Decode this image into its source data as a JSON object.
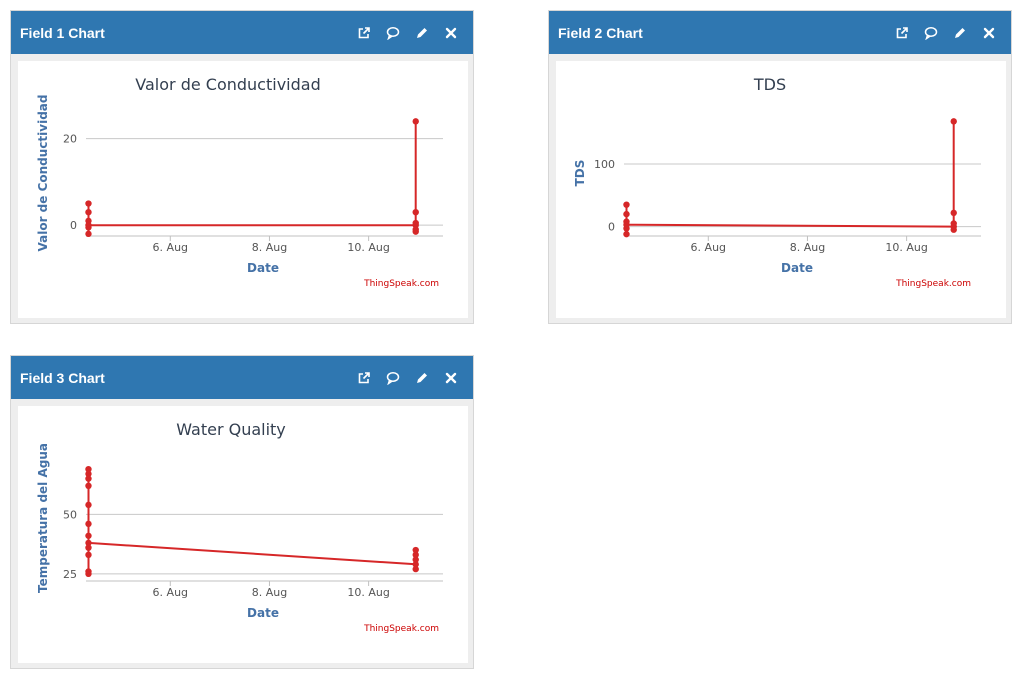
{
  "widgets": [
    {
      "title": "Field 1 Chart",
      "tools": [
        "external-link-icon",
        "comment-icon",
        "pencil-icon",
        "close-icon"
      ],
      "chart_data": {
        "type": "line",
        "title": "Valor de Conductividad",
        "xlabel": "Date",
        "ylabel": "Valor de Conductividad",
        "x_ticks": [
          {
            "day": 6,
            "label": "6. Aug"
          },
          {
            "day": 8,
            "label": "8. Aug"
          },
          {
            "day": 10,
            "label": "10. Aug"
          }
        ],
        "y_ticks": [
          0,
          20
        ],
        "xlim": [
          4.3,
          11.5
        ],
        "ylim": [
          -2.5,
          25
        ],
        "grid": true,
        "credit": "ThingSpeak.com",
        "color": "#d62728",
        "series": [
          {
            "points": [
              {
                "day": 4.35,
                "y": 5
              },
              {
                "day": 4.35,
                "y": 3
              },
              {
                "day": 4.35,
                "y": 1
              },
              {
                "day": 4.35,
                "y": -0.5
              },
              {
                "day": 4.35,
                "y": -2
              },
              {
                "day": 4.35,
                "y": 0
              },
              {
                "day": 10.95,
                "y": 0
              },
              {
                "day": 10.95,
                "y": 0.5
              },
              {
                "day": 10.95,
                "y": -1
              },
              {
                "day": 10.95,
                "y": -1.5
              },
              {
                "day": 10.95,
                "y": 3
              },
              {
                "day": 10.95,
                "y": 24
              }
            ]
          }
        ]
      }
    },
    {
      "title": "Field 2 Chart",
      "tools": [
        "external-link-icon",
        "comment-icon",
        "pencil-icon",
        "close-icon"
      ],
      "chart_data": {
        "type": "line",
        "title": "TDS",
        "xlabel": "Date",
        "ylabel": "TDS",
        "x_ticks": [
          {
            "day": 6,
            "label": "6. Aug"
          },
          {
            "day": 8,
            "label": "8. Aug"
          },
          {
            "day": 10,
            "label": "10. Aug"
          }
        ],
        "y_ticks": [
          0,
          100
        ],
        "xlim": [
          4.3,
          11.5
        ],
        "ylim": [
          -15,
          175
        ],
        "grid": true,
        "credit": "ThingSpeak.com",
        "color": "#d62728",
        "series": [
          {
            "points": [
              {
                "day": 4.35,
                "y": 35
              },
              {
                "day": 4.35,
                "y": 20
              },
              {
                "day": 4.35,
                "y": 8
              },
              {
                "day": 4.35,
                "y": -3
              },
              {
                "day": 4.35,
                "y": -12
              },
              {
                "day": 4.35,
                "y": 3
              },
              {
                "day": 10.95,
                "y": 0
              },
              {
                "day": 10.95,
                "y": 5
              },
              {
                "day": 10.95,
                "y": -5
              },
              {
                "day": 10.95,
                "y": 22
              },
              {
                "day": 10.95,
                "y": 168
              }
            ]
          }
        ]
      }
    },
    {
      "title": "Field 3 Chart",
      "tools": [
        "external-link-icon",
        "comment-icon",
        "pencil-icon",
        "close-icon"
      ],
      "chart_data": {
        "type": "line",
        "title": "Water Quality",
        "xlabel": "Date",
        "ylabel": "Temperatura del Agua",
        "x_ticks": [
          {
            "day": 6,
            "label": "6. Aug"
          },
          {
            "day": 8,
            "label": "8. Aug"
          },
          {
            "day": 10,
            "label": "10. Aug"
          }
        ],
        "y_ticks": [
          25,
          50
        ],
        "xlim": [
          4.3,
          11.5
        ],
        "ylim": [
          22,
          72
        ],
        "grid": true,
        "credit": "ThingSpeak.com",
        "color": "#d62728",
        "series": [
          {
            "points": [
              {
                "day": 4.35,
                "y": 69
              },
              {
                "day": 4.35,
                "y": 67
              },
              {
                "day": 4.35,
                "y": 65
              },
              {
                "day": 4.35,
                "y": 62
              },
              {
                "day": 4.35,
                "y": 54
              },
              {
                "day": 4.35,
                "y": 46
              },
              {
                "day": 4.35,
                "y": 41
              },
              {
                "day": 4.35,
                "y": 36
              },
              {
                "day": 4.35,
                "y": 33
              },
              {
                "day": 4.35,
                "y": 26
              },
              {
                "day": 4.35,
                "y": 25
              },
              {
                "day": 4.35,
                "y": 38
              },
              {
                "day": 10.95,
                "y": 29
              },
              {
                "day": 10.95,
                "y": 27
              },
              {
                "day": 10.95,
                "y": 31
              },
              {
                "day": 10.95,
                "y": 33
              },
              {
                "day": 10.95,
                "y": 35
              }
            ]
          }
        ]
      }
    }
  ]
}
